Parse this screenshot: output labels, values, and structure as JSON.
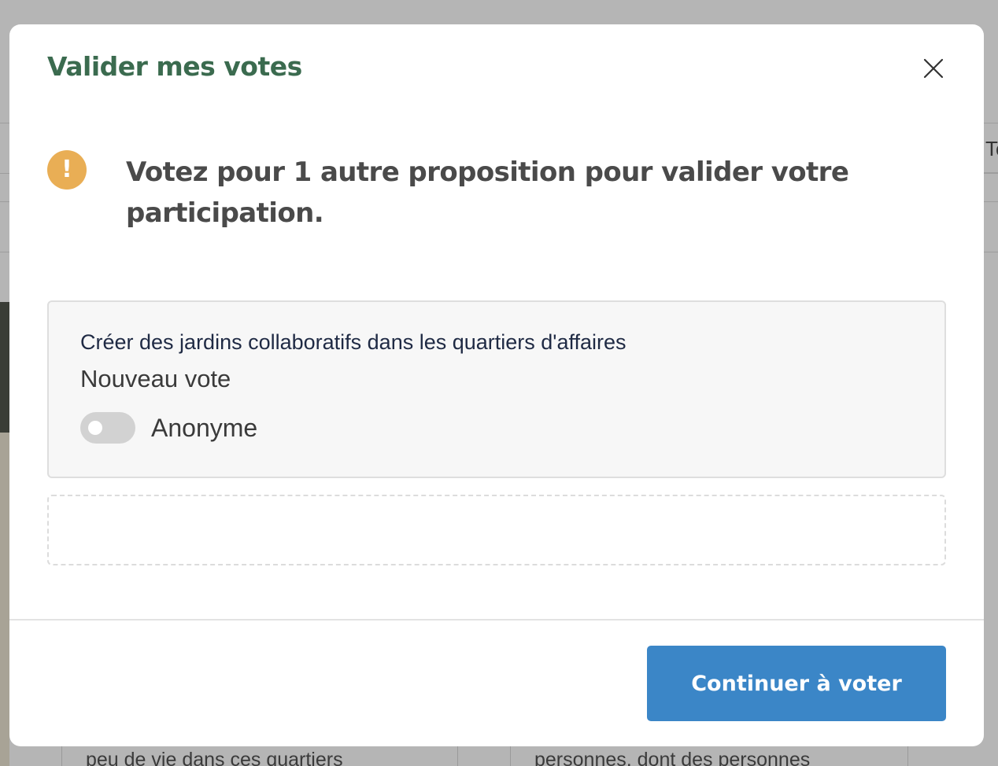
{
  "background": {
    "right_tab_fragment": "To",
    "card_left_text": "peu de vie dans ces quartiers",
    "card_right_text": "personnes, dont des personnes"
  },
  "modal": {
    "title": "Valider mes votes",
    "close_icon": "close-icon",
    "warning": {
      "icon": "exclamation-icon",
      "icon_glyph": "!",
      "text": "Votez pour 1 autre proposition pour valider votre participation."
    },
    "vote_card": {
      "proposal_title": "Créer des jardins collaboratifs dans les quartiers d'affaires",
      "status": "Nouveau vote",
      "anonymous_label": "Anonyme",
      "anonymous_enabled": false
    },
    "continue_button": "Continuer à voter"
  },
  "colors": {
    "title_green": "#3b6b4f",
    "warning_orange": "#e9ae55",
    "button_blue": "#3b86c7",
    "overlay_gray": "#b5b5b5"
  }
}
